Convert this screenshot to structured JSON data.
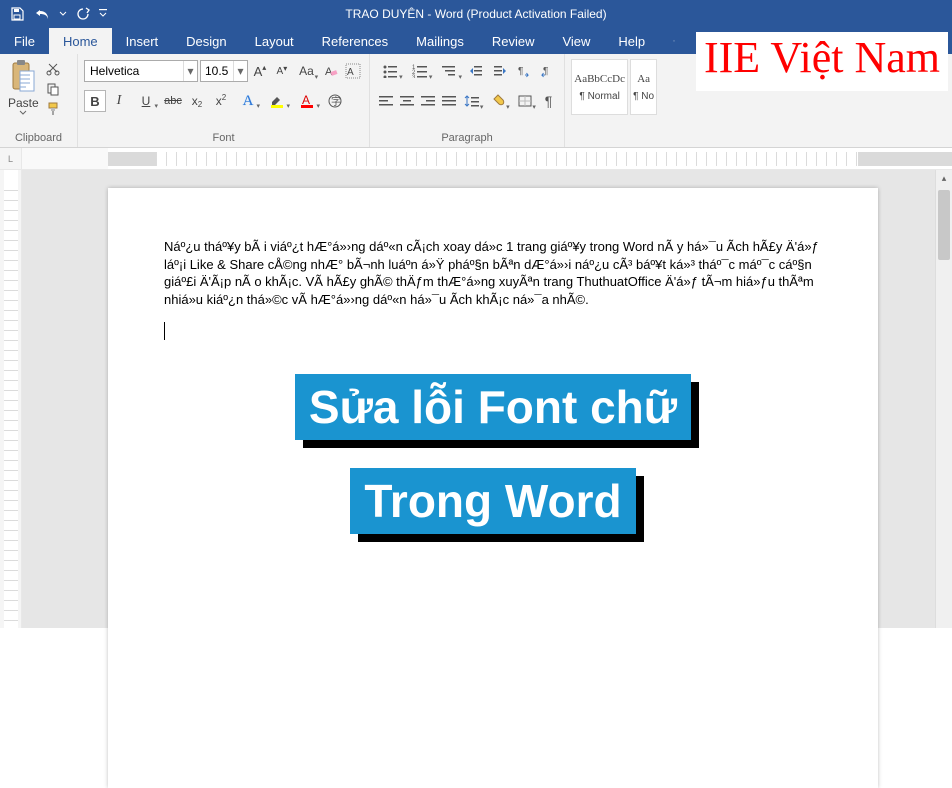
{
  "titlebar": {
    "doc_title": "TRAO DUYÊN  -  Word (Product Activation Failed)"
  },
  "tabs": {
    "file": "File",
    "home": "Home",
    "insert": "Insert",
    "design": "Design",
    "layout": "Layout",
    "references": "References",
    "mailings": "Mailings",
    "review": "Review",
    "view": "View",
    "help": "Help"
  },
  "ribbon": {
    "clipboard": {
      "label": "Clipboard",
      "paste": "Paste"
    },
    "font": {
      "label": "Font",
      "name": "Helvetica",
      "size": "10.5",
      "bold": "B",
      "italic": "I",
      "underline": "U",
      "strike": "abc",
      "sub": "x",
      "sup": "x",
      "caseA": "A",
      "aa": "Aa"
    },
    "paragraph": {
      "label": "Paragraph"
    },
    "styles": {
      "preview": "AaBbCcDc",
      "name1": "¶ Normal",
      "preview2": "Aa",
      "name2": "¶ No"
    }
  },
  "ruler": {
    "corner": "L"
  },
  "document": {
    "body": "Náº¿u tháº¥y bÃ i viáº¿t hÆ°á»›ng dáº«n cÃ¡ch xoay dá»c 1 trang giáº¥y trong Word nÃ y há»¯u Ã­ch hÃ£y Ä'á»ƒ láº¡i Like & Share cÅ©ng nhÆ° bÃ¬nh luáº­n á»Ÿ pháº§n bÃªn dÆ°á»›i náº¿u cÃ³ báº¥t ká»³ tháº¯c máº¯c cáº§n giáº£i Ä'Ã¡p nÃ o khÃ¡c. VÃ  hÃ£y ghÃ© thÄƒm thÆ°á»ng xuyÃªn trang ThuthuatOffice Ä'á»ƒ tÃ¬m hiá»ƒu thÃªm nhiá»u kiáº¿n thá»©c vÃ  hÆ°á»›ng dáº«n há»¯u Ã­ch khÃ¡c ná»¯a nhÃ©.",
    "headline1": "Sửa lỗi Font chữ",
    "headline2": "Trong Word"
  },
  "overlay": {
    "brand": "IIE Việt Nam"
  }
}
